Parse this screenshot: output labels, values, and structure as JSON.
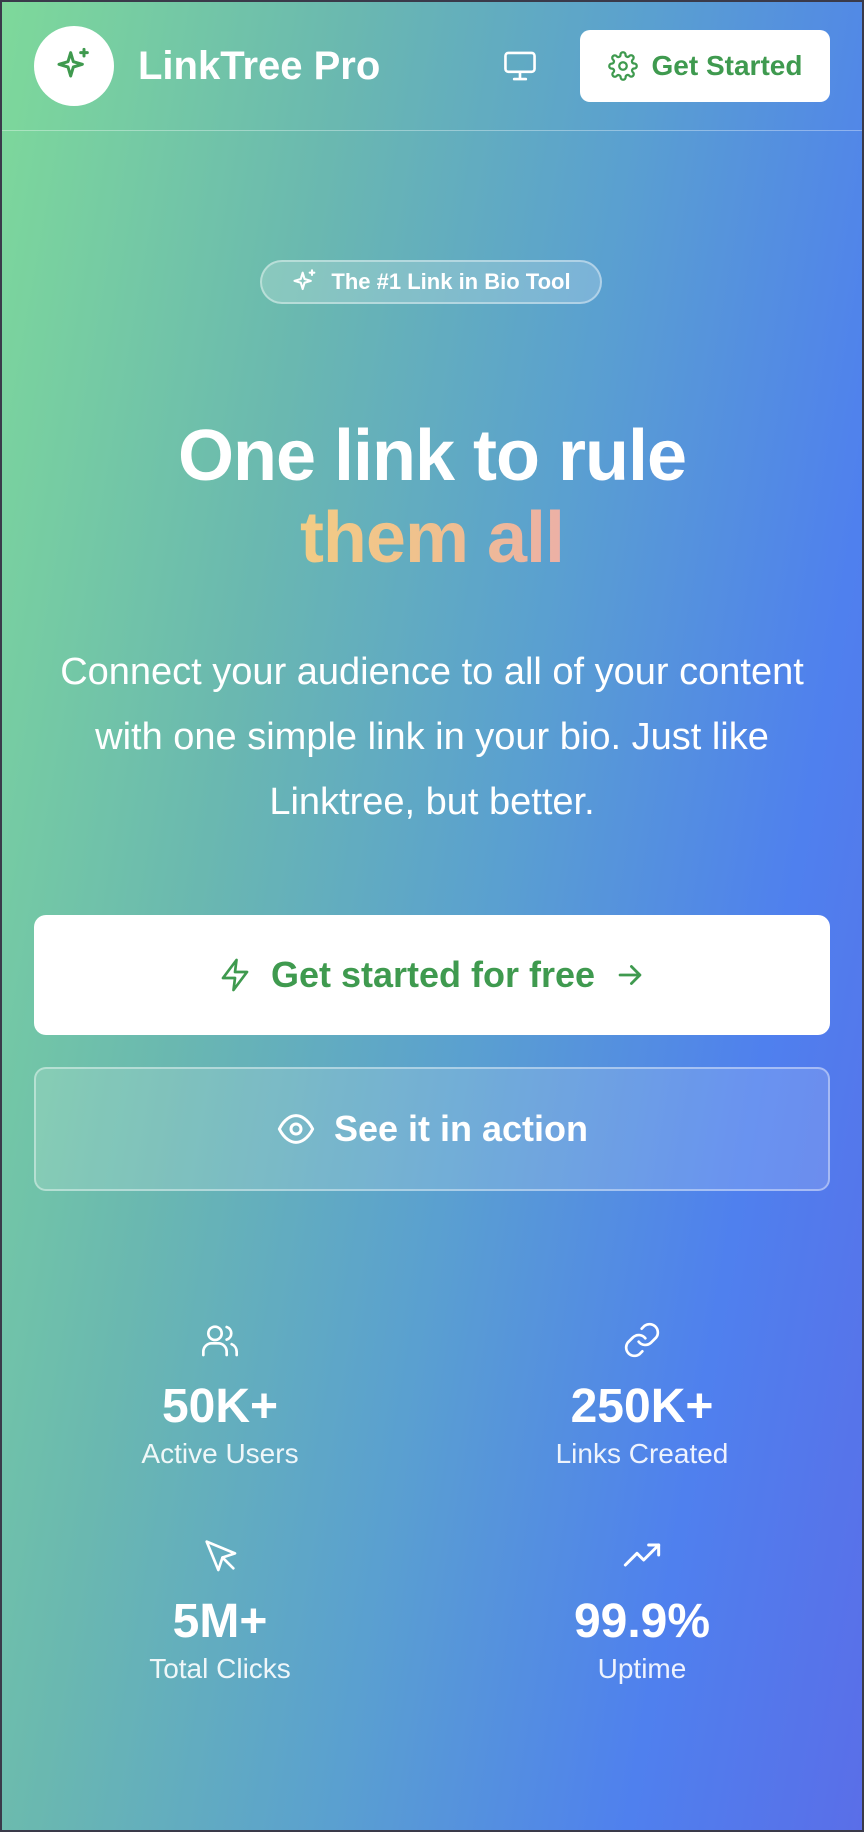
{
  "header": {
    "brand": "LinkTree Pro",
    "logo_icon": "sparkles-icon",
    "monitor_icon": "monitor-icon",
    "cta_label": "Get Started",
    "cta_icon": "gear-icon"
  },
  "hero": {
    "badge": "The #1 Link in Bio Tool",
    "badge_icon": "sparkles-icon",
    "headline_line1": "One link to rule",
    "headline_line2": "them all",
    "subtitle": "Connect your audience to all of your content with one simple link in your bio. Just like Linktree, but better.",
    "primary_cta": "Get started for free",
    "primary_cta_icons": [
      "lightning-icon",
      "arrow-right-icon"
    ],
    "secondary_cta": "See it in action",
    "secondary_cta_icon": "eye-icon"
  },
  "stats": [
    {
      "value": "50K+",
      "label": "Active Users",
      "icon": "users-icon"
    },
    {
      "value": "250K+",
      "label": "Links Created",
      "icon": "link-icon"
    },
    {
      "value": "5M+",
      "label": "Total Clicks",
      "icon": "cursor-icon"
    },
    {
      "value": "99.9%",
      "label": "Uptime",
      "icon": "trending-up-icon"
    }
  ],
  "colors": {
    "accent_green": "#3f9a4f",
    "gradient_start": "#7ed99a",
    "gradient_end": "#5a6ee8",
    "headline_highlight": "#f3cc85"
  }
}
